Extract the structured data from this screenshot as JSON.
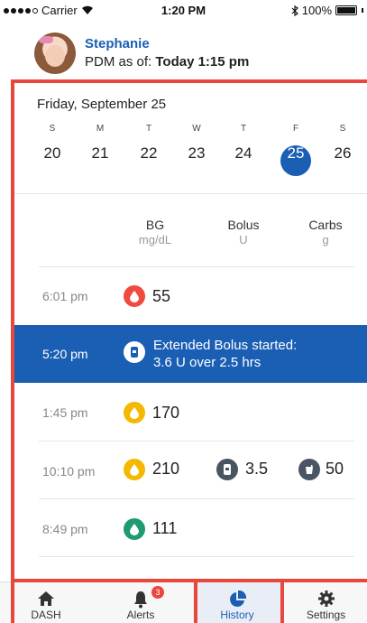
{
  "status_bar": {
    "carrier": "Carrier",
    "time": "1:20 PM",
    "battery": "100%"
  },
  "header": {
    "user_name": "Stephanie",
    "pdm_prefix": "PDM as of:",
    "pdm_time": "Today 1:15 pm"
  },
  "calendar": {
    "date_title": "Friday, September 25",
    "days": [
      {
        "letter": "S",
        "num": "20"
      },
      {
        "letter": "M",
        "num": "21"
      },
      {
        "letter": "T",
        "num": "22"
      },
      {
        "letter": "W",
        "num": "23"
      },
      {
        "letter": "T",
        "num": "24"
      },
      {
        "letter": "F",
        "num": "25",
        "selected": true
      },
      {
        "letter": "S",
        "num": "26"
      }
    ]
  },
  "columns": {
    "bg": {
      "label": "BG",
      "unit": "mg/dL"
    },
    "bolus": {
      "label": "Bolus",
      "unit": "U"
    },
    "carbs": {
      "label": "Carbs",
      "unit": "g"
    }
  },
  "rows": [
    {
      "time": "6:01 pm",
      "bg": "55",
      "bg_color": "#ef4b3f"
    },
    {
      "time": "5:20 pm",
      "event_line1": "Extended Bolus started:",
      "event_line2": "3.6 U over 2.5 hrs"
    },
    {
      "time": "1:45 pm",
      "bg": "170",
      "bg_color": "#f5b800"
    },
    {
      "time": "10:10 pm",
      "bg": "210",
      "bg_color": "#f5b800",
      "bolus": "3.5",
      "carbs": "50"
    },
    {
      "time": "8:49 pm",
      "bg": "111",
      "bg_color": "#1f9a73"
    }
  ],
  "tabs": {
    "dash": "DASH",
    "alerts": "Alerts",
    "alerts_count": "3",
    "history": "History",
    "settings": "Settings"
  },
  "colors": {
    "accent": "#1a5fb4",
    "frame": "#e8473b",
    "low": "#ef4b3f",
    "high": "#f5b800",
    "in_range": "#1f9a73"
  }
}
